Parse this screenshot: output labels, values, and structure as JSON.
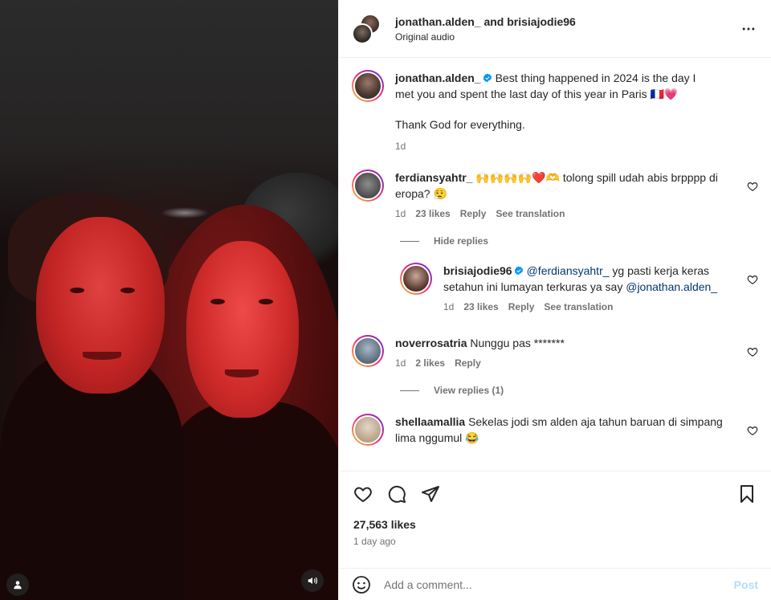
{
  "header": {
    "title": "jonathan.alden_ and brisiajodie96",
    "subtitle": "Original audio"
  },
  "caption": {
    "username": "jonathan.alden_",
    "text_line1": "Best thing happened in 2024 is the day I met you and spent the last day of this year in Paris 🇫🇷💗",
    "text_line2": "Thank God for everything.",
    "time": "1d"
  },
  "comments": [
    {
      "username": "ferdiansyahtr_",
      "text": "🙌🙌🙌🙌❤️🫶 tolong spill udah abis brpppp di eropa? 😮‍💨",
      "time": "1d",
      "likes": "23 likes",
      "reply_label": "Reply",
      "translate_label": "See translation",
      "replies_toggle": "Hide replies",
      "replies": [
        {
          "username": "brisiajodie96",
          "mention": "@ferdiansyahtr_",
          "text": " yg pasti kerja keras setahun ini lumayan terkuras ya say ",
          "mention2": "@jonathan.alden_",
          "time": "1d",
          "likes": "23 likes",
          "reply_label": "Reply",
          "translate_label": "See translation"
        }
      ]
    },
    {
      "username": "noverrosatria",
      "text": "Nunggu pas *******",
      "time": "1d",
      "likes": "2 likes",
      "reply_label": "Reply",
      "replies_toggle": "View replies (1)"
    },
    {
      "username": "shellaamallia",
      "text": "Sekelas jodi sm alden aja tahun baruan di simpang lima nggumul 😂"
    }
  ],
  "actions": {
    "likes": "27,563 likes",
    "time_ago": "1 day ago"
  },
  "composer": {
    "placeholder": "Add a comment...",
    "post_label": "Post"
  },
  "colors": {
    "accent": "#0095f6",
    "post_disabled": "#b3dbff",
    "muted": "#737373"
  }
}
